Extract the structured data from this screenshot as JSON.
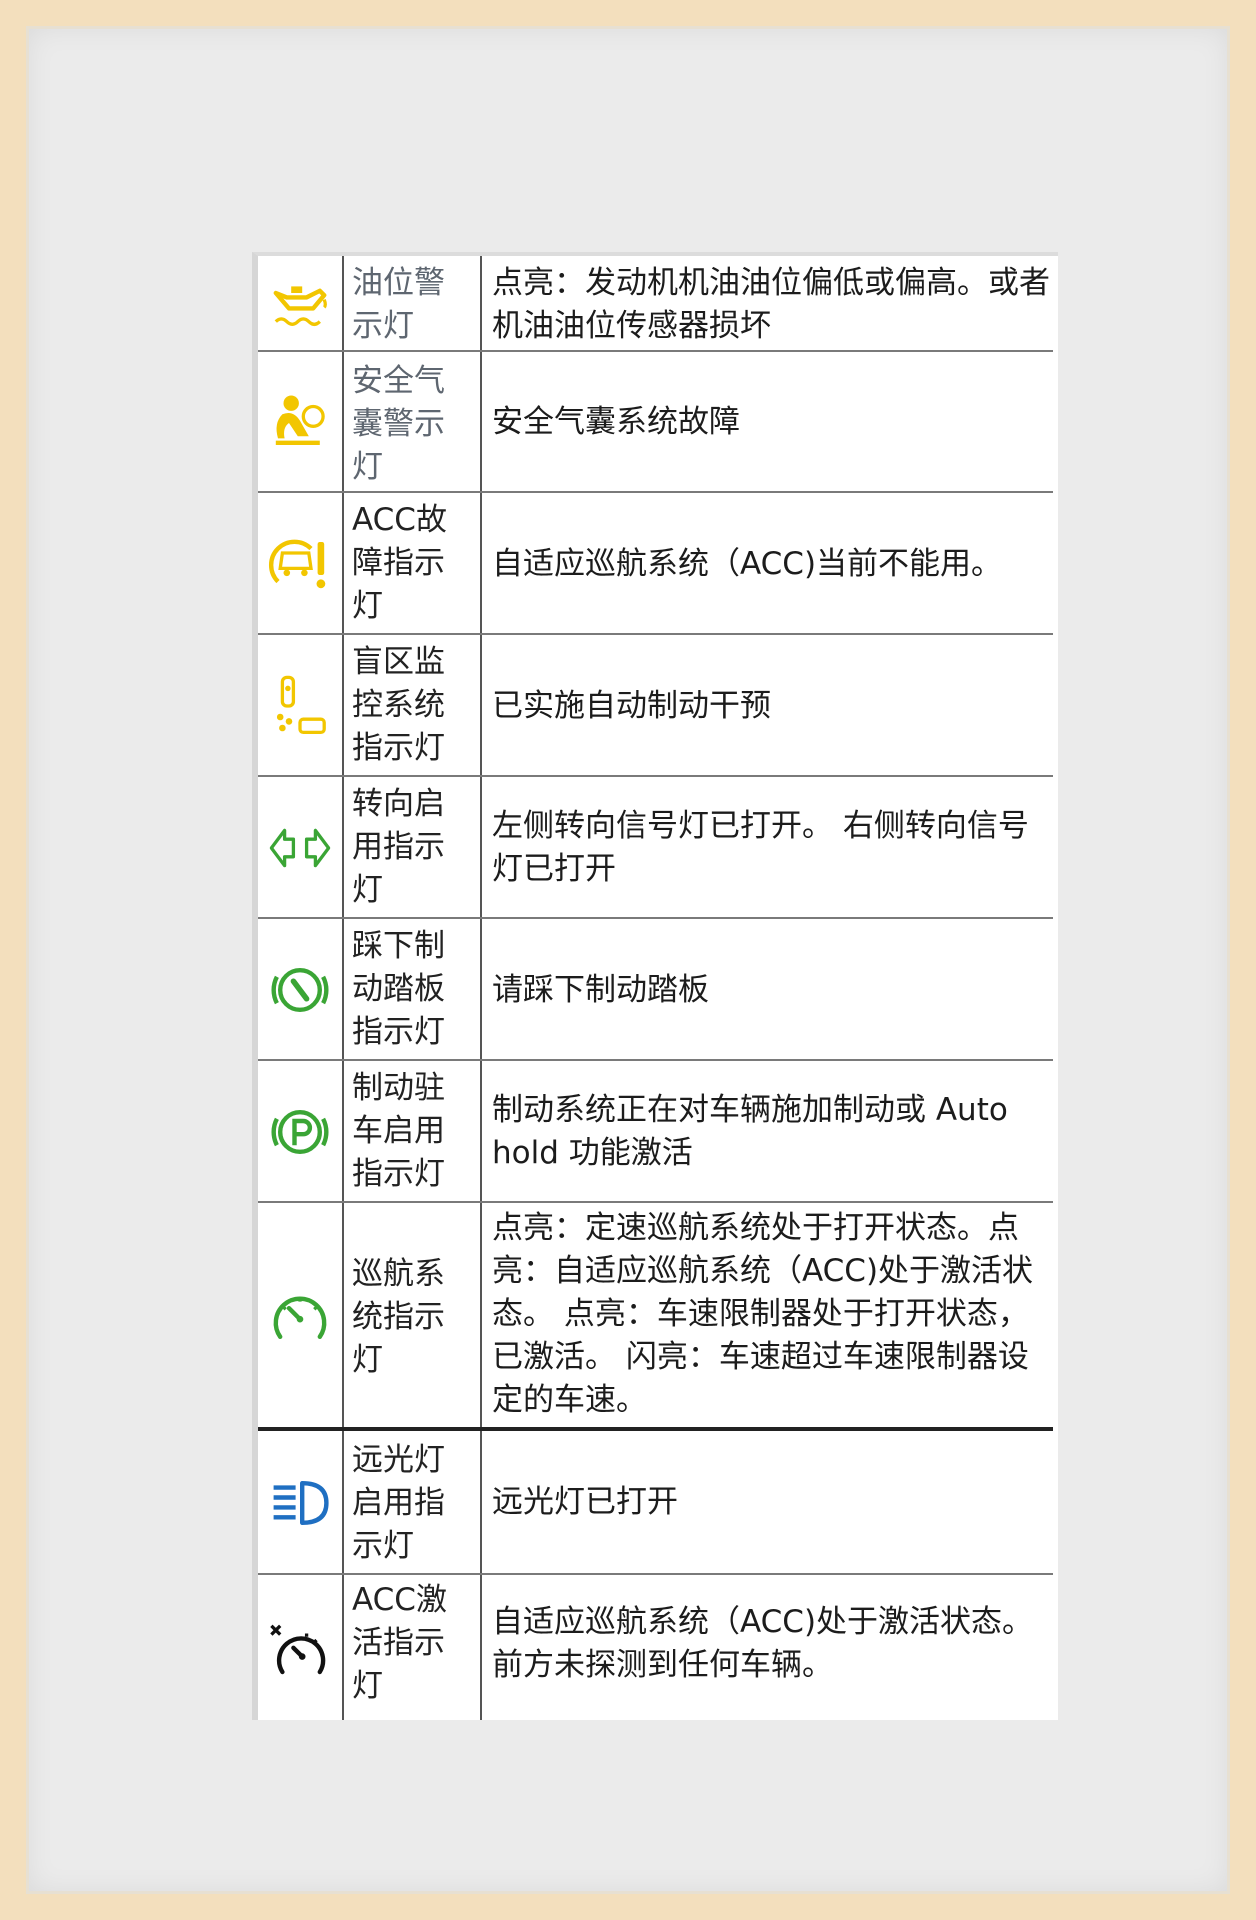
{
  "rows": [
    {
      "icon": "oil-level-warning-icon",
      "name": "油位警示灯",
      "desc": "点亮：发动机机油油位偏低或偏高。或者机油油位传感器损坏"
    },
    {
      "icon": "airbag-warning-icon",
      "name": "安全气囊警示灯",
      "desc": "安全气囊系统故障"
    },
    {
      "icon": "acc-fault-icon",
      "name": "ACC故障指示灯",
      "desc": "自适应巡航系统（ACC)当前不能用。"
    },
    {
      "icon": "blind-spot-monitor-icon",
      "name": "盲区监控系统指示灯",
      "desc": "已实施自动制动干预"
    },
    {
      "icon": "turn-signal-icon",
      "name": "转向启用指示灯",
      "desc": "左侧转向信号灯已打开。 右侧转向信号灯已打开"
    },
    {
      "icon": "press-brake-pedal-icon",
      "name": "踩下制动踏板指示灯",
      "desc": "请踩下制动踏板"
    },
    {
      "icon": "parking-brake-icon",
      "name": "制动驻车启用指示灯",
      "desc": "制动系统正在对车辆施加制动或 Auto hold 功能激活"
    },
    {
      "icon": "cruise-control-icon",
      "name": "巡航系统指示灯",
      "desc": "点亮：定速巡航系统处于打开状态。点亮：自适应巡航系统（ACC)处于激活状态。 点亮：车速限制器处于打开状态，已激活。 闪亮：车速超过车速限制器设定的车速。"
    },
    {
      "icon": "high-beam-icon",
      "name": "远光灯启用指示灯",
      "desc": "远光灯已打开"
    },
    {
      "icon": "acc-active-icon",
      "name": "ACC激活指示灯",
      "desc": "自适应巡航系统（ACC)处于激活状态。前方未探测到任何车辆。"
    }
  ],
  "colors": {
    "yellow": "#f2c600",
    "green": "#3aa535",
    "blue": "#1f6fc2",
    "black": "#111111"
  }
}
